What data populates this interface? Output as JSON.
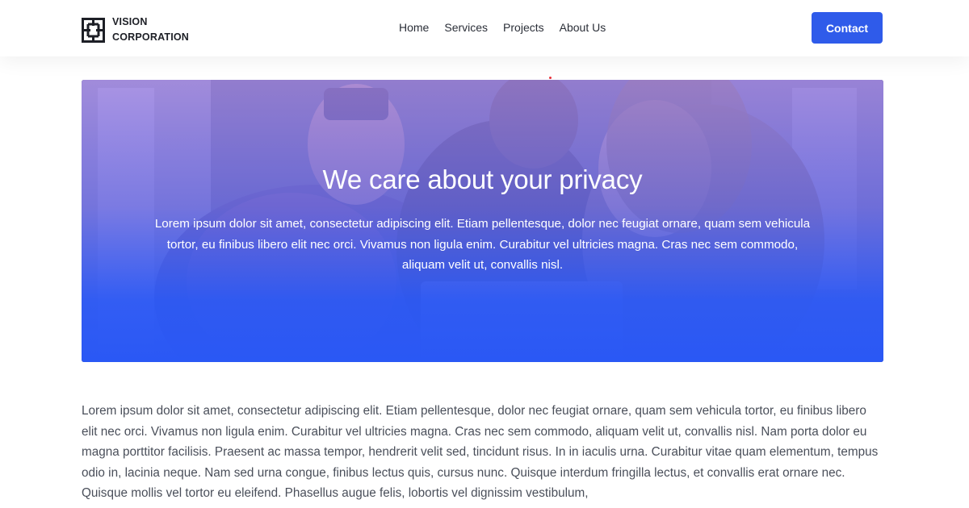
{
  "brand": {
    "line1": "VISION",
    "line2": "CORPORATION",
    "logo_icon": "maze-square-logo"
  },
  "nav": {
    "items": [
      {
        "label": "Home"
      },
      {
        "label": "Services"
      },
      {
        "label": "Projects"
      },
      {
        "label": "About Us"
      }
    ],
    "contact_label": "Contact"
  },
  "hero": {
    "title": "We care about your privacy",
    "text": "Lorem ipsum dolor sit amet, consectetur adipiscing elit. Etiam pellentesque, dolor nec feugiat ornare, quam sem vehicula tortor, eu finibus libero elit nec orci. Vivamus non ligula enim. Curabitur vel ultricies magna. Cras nec sem commodo, aliquam velit ut, convallis nisl."
  },
  "body": {
    "text": "Lorem ipsum dolor sit amet, consectetur adipiscing elit. Etiam pellentesque, dolor nec feugiat ornare, quam sem vehicula tortor, eu finibus libero elit nec orci. Vivamus non ligula enim. Curabitur vel ultricies magna. Cras nec sem commodo, aliquam velit ut, convallis nisl. Nam porta dolor eu magna porttitor facilisis. Praesent ac massa tempor, hendrerit velit sed, tincidunt risus. In in iaculis urna. Curabitur vitae quam elementum, tempus odio in, lacinia neque. Nam sed urna congue, finibus lectus quis, cursus nunc. Quisque interdum fringilla lectus, et convallis erat ornare nec. Quisque mollis vel tortor eu eleifend. Phasellus augue felis, lobortis vel dignissim vestibulum,"
  },
  "colors": {
    "accent": "#2f5bea",
    "hero_gradient_top": "#a98cf0",
    "hero_gradient_bottom": "#2a58f5",
    "body_text": "#4a4f5a"
  }
}
